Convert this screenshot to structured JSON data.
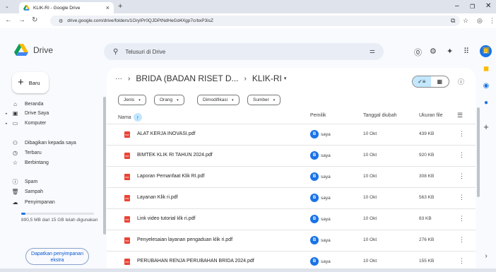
{
  "browser": {
    "tab_title": "KLIK-RI - Google Drive",
    "url": "drive.google.com/drive/folders/1OryIPr0QJDPtNdHeGd4Xgp7crbxP3isZ"
  },
  "header": {
    "logo_text": "Drive",
    "search_placeholder": "Telusuri di Drive",
    "avatar_letter": "B"
  },
  "sidebar": {
    "new_label": "Baru",
    "items": [
      {
        "label": "Beranda",
        "icon": "home-icon"
      },
      {
        "label": "Drive Saya",
        "icon": "my-drive-icon"
      },
      {
        "label": "Komputer",
        "icon": "computer-icon"
      },
      {
        "label": "Dibagikan kepada saya",
        "icon": "shared-icon"
      },
      {
        "label": "Terbaru",
        "icon": "recent-icon"
      },
      {
        "label": "Berbintang",
        "icon": "star-icon"
      },
      {
        "label": "Spam",
        "icon": "spam-icon"
      },
      {
        "label": "Sampah",
        "icon": "trash-icon"
      },
      {
        "label": "Penyimpanan",
        "icon": "cloud-icon"
      }
    ],
    "storage_text": "890,5 MB dari 15 GB telah digunakan",
    "storage_fraction": 0.06,
    "get_storage_label": "Dapatkan penyimpanan ekstra"
  },
  "main": {
    "breadcrumb_parent": "BRIDA (BADAN RISET D...",
    "breadcrumb_current": "KLIK-RI",
    "filters": [
      "Jenis",
      "Orang",
      "Dimodifikasi",
      "Sumber"
    ],
    "columns": {
      "name": "Nama",
      "owner": "Pemilik",
      "modified": "Tanggal diubah",
      "size": "Ukuran file"
    },
    "files": [
      {
        "name": "ALAT KERJA INOVASI.pdf",
        "owner": "saya",
        "date": "10 Okt",
        "size": "439 KB"
      },
      {
        "name": "BIMTEK KLIK RI TAHUN 2024.pdf",
        "owner": "saya",
        "date": "10 Okt",
        "size": "920 KB"
      },
      {
        "name": "Laporan Pemanfaat Klik RI.pdf",
        "owner": "saya",
        "date": "10 Okt",
        "size": "308 KB"
      },
      {
        "name": "Layanan Klik ri.pdf",
        "owner": "saya",
        "date": "10 Okt",
        "size": "563 KB"
      },
      {
        "name": "Link video tutorial klk ri.pdf",
        "owner": "saya",
        "date": "10 Okt",
        "size": "83 KB"
      },
      {
        "name": "Penyelesaian layanan pengaduan klik ri.pdf",
        "owner": "saya",
        "date": "10 Okt",
        "size": "276 KB"
      },
      {
        "name": "PERUBAHAN RENJA PERUBAHAN BRIDA 2024.pdf",
        "owner": "saya",
        "date": "10 Okt",
        "size": "155 KB"
      }
    ],
    "owner_badge": "B"
  },
  "colors": {
    "accent": "#1a73e8",
    "pdf": "#ea4335",
    "selected_view": "#c2e7ff"
  }
}
